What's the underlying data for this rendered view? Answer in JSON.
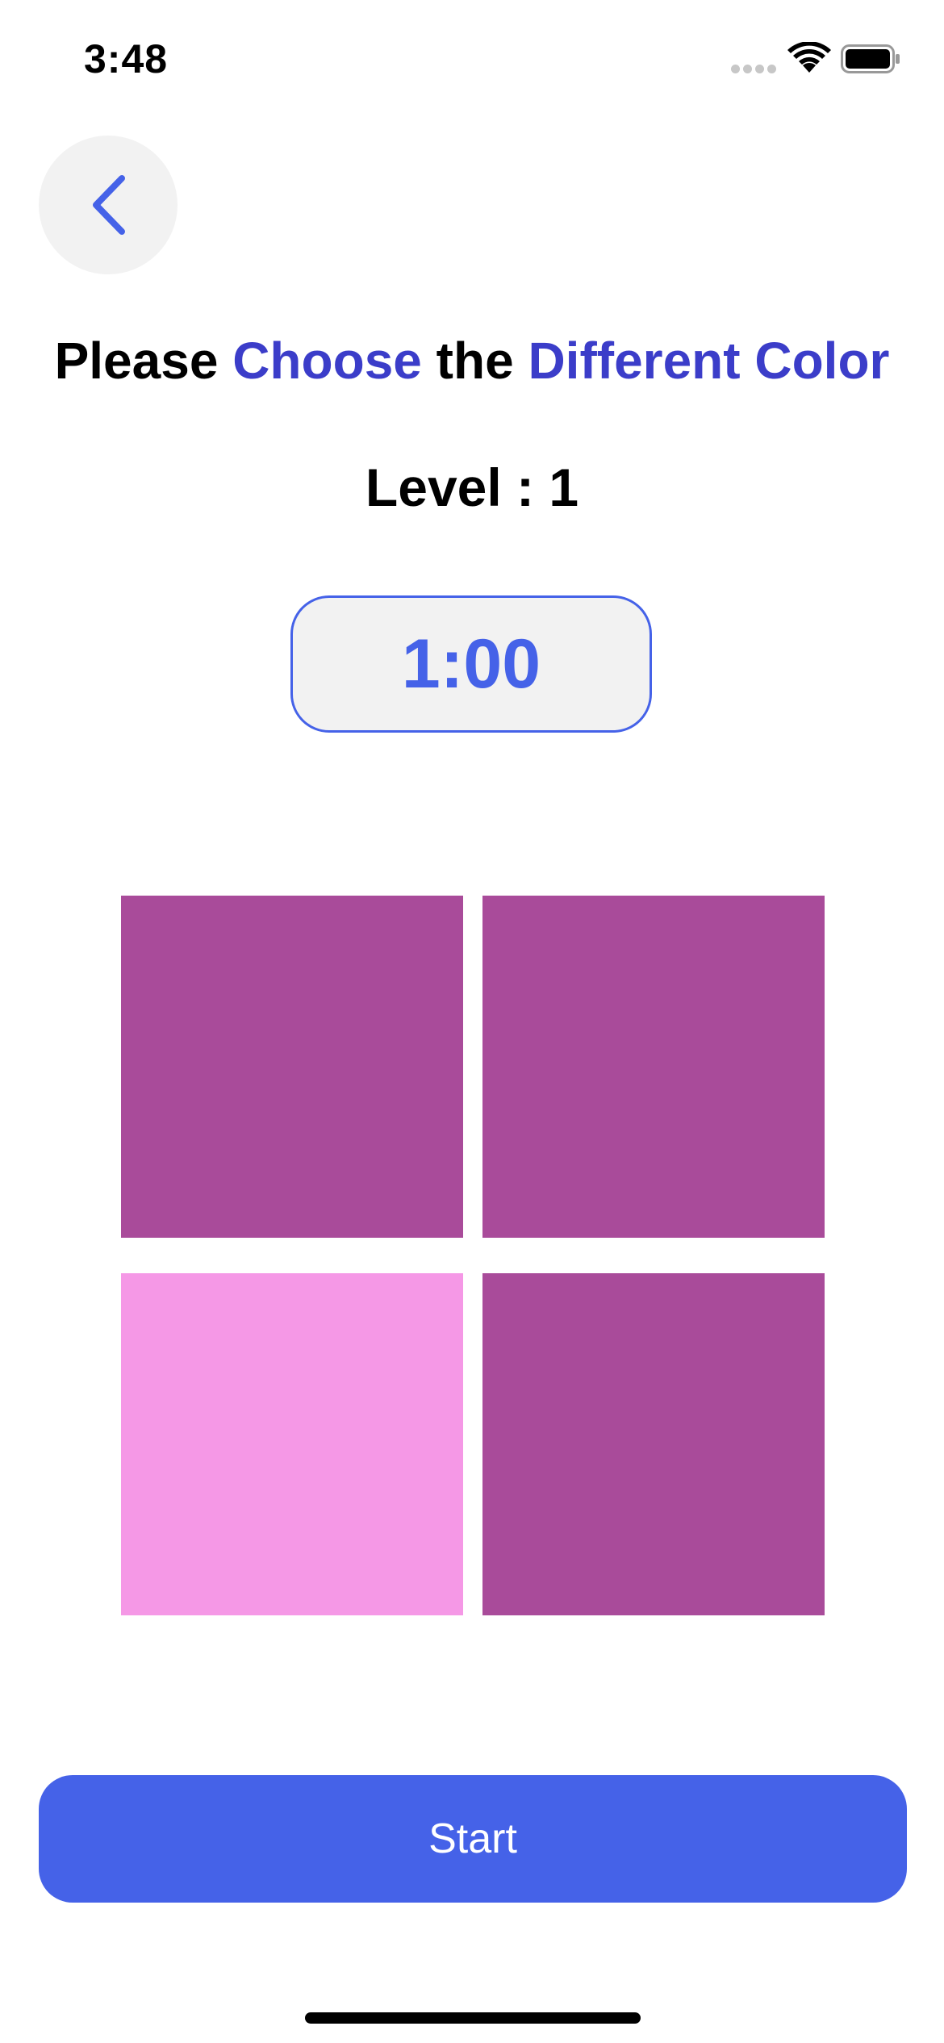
{
  "status_bar": {
    "time": "3:48",
    "icons": [
      "signal-icon",
      "wifi-icon",
      "battery-icon"
    ]
  },
  "header": {
    "back_icon": "chevron-left-icon"
  },
  "title": {
    "part1": "Please ",
    "part2": "Choose",
    "part3": " the ",
    "part4": "Different Color"
  },
  "level": {
    "text": "Level : 1"
  },
  "timer": {
    "value": "1:00"
  },
  "grid": {
    "tiles": [
      {
        "color": "#a94b9a",
        "is_different": false
      },
      {
        "color": "#a94b9a",
        "is_different": false
      },
      {
        "color": "#f598e6",
        "is_different": true
      },
      {
        "color": "#a94b9a",
        "is_different": false
      }
    ]
  },
  "actions": {
    "start_label": "Start"
  },
  "colors": {
    "accent_text": "#3b3dc9",
    "primary_button": "#4562e8",
    "back_button_bg": "#f2f2f2"
  }
}
